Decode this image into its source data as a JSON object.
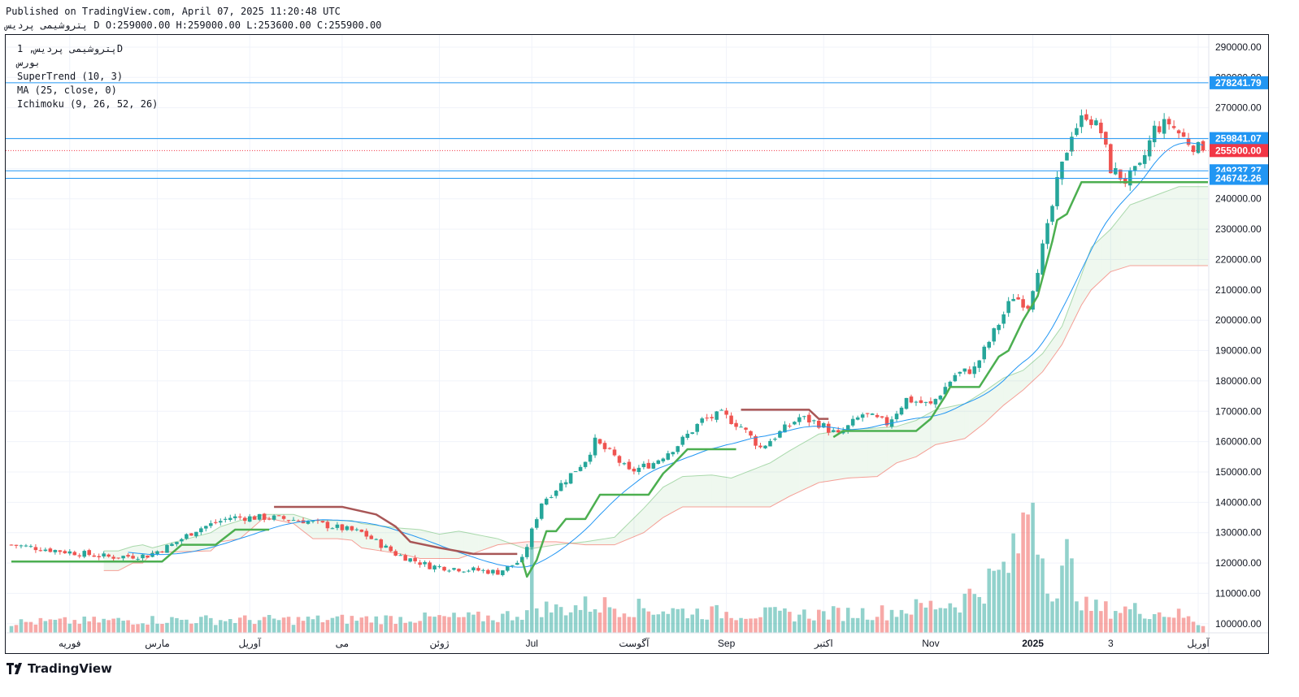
{
  "header": {
    "published": "Published on TradingView.com, April 07, 2025 11:20:48 UTC",
    "symbol_line": "پتروشیمی پردیس D O:259000.00 H:259000.00 L:253600.00 C:255900.00"
  },
  "legend": {
    "title": "پتروشیمی پردیس, 1D",
    "exchange": "بورس",
    "indicators": [
      "SuperTrend (10, 3)",
      "MA (25, close, 0)",
      "Ichimoku (9, 26, 52, 26)"
    ]
  },
  "brand": {
    "name": "TradingView",
    "icon": "tradingview-logo-icon"
  },
  "colors": {
    "up": "#26a69a",
    "down": "#ef5350",
    "supertrend_up": "#4caf50",
    "supertrend_down": "#a85656",
    "ma": "#2196f3",
    "hline": "#2196f3",
    "last_price": "#f23645",
    "cloud_bull": "#4caf50",
    "cloud_bear": "#f44336"
  },
  "chart_data": {
    "type": "candlestick",
    "title": "پتروشیمی پردیس, 1D",
    "ylim": [
      97000,
      294000
    ],
    "y_ticks": [
      100000,
      110000,
      120000,
      130000,
      140000,
      150000,
      160000,
      170000,
      180000,
      190000,
      200000,
      210000,
      220000,
      230000,
      240000,
      250000,
      260000,
      270000,
      280000,
      290000
    ],
    "y_tick_labels": [
      "100000.00",
      "110000.00",
      "120000.00",
      "130000.00",
      "140000.00",
      "150000.00",
      "160000.00",
      "170000.00",
      "180000.00",
      "190000.00",
      "200000.00",
      "210000.00",
      "220000.00",
      "230000.00",
      "240000.00",
      "250000.00",
      "260000.00",
      "270000.00",
      "280000.00",
      "290000.00"
    ],
    "x_labels": [
      {
        "label": "فوریه",
        "idx": 12
      },
      {
        "label": "مارس",
        "idx": 30
      },
      {
        "label": "آوریل",
        "idx": 49
      },
      {
        "label": "می",
        "idx": 68
      },
      {
        "label": "ژوئن",
        "idx": 88
      },
      {
        "label": "Jul",
        "idx": 107
      },
      {
        "label": "آگوست",
        "idx": 128
      },
      {
        "label": "Sep",
        "idx": 147
      },
      {
        "label": "اکتبر",
        "idx": 167
      },
      {
        "label": "Nov",
        "idx": 189
      },
      {
        "label": "2025",
        "idx": 210
      },
      {
        "label": "3",
        "idx": 226
      },
      {
        "label": "آوریل",
        "idx": 244
      }
    ],
    "horizontal_lines": [
      278241.79,
      259841.07,
      249237.27,
      246742.26
    ],
    "horizontal_line_labels": [
      "278241.79",
      "259841.07",
      "249237.27",
      "246742.26"
    ],
    "last_price": 255900,
    "last_price_label": "255900.00",
    "anchors": [
      [
        0,
        126000
      ],
      [
        10,
        124000
      ],
      [
        20,
        122000
      ],
      [
        28,
        122500
      ],
      [
        33,
        126000
      ],
      [
        38,
        131000
      ],
      [
        45,
        135000
      ],
      [
        53,
        135000
      ],
      [
        60,
        134000
      ],
      [
        66,
        132000
      ],
      [
        72,
        130000
      ],
      [
        79,
        123000
      ],
      [
        86,
        119000
      ],
      [
        93,
        118000
      ],
      [
        100,
        117000
      ],
      [
        105,
        121000
      ],
      [
        109,
        140000
      ],
      [
        113,
        146000
      ],
      [
        118,
        154000
      ],
      [
        120,
        160000
      ],
      [
        124,
        155000
      ],
      [
        127,
        150000
      ],
      [
        132,
        153000
      ],
      [
        137,
        159000
      ],
      [
        142,
        167000
      ],
      [
        146,
        169000
      ],
      [
        150,
        165000
      ],
      [
        154,
        158000
      ],
      [
        158,
        163000
      ],
      [
        162,
        168000
      ],
      [
        166,
        166000
      ],
      [
        170,
        162000
      ],
      [
        175,
        169000
      ],
      [
        180,
        166000
      ],
      [
        184,
        174000
      ],
      [
        189,
        172000
      ],
      [
        194,
        182000
      ],
      [
        198,
        184000
      ],
      [
        202,
        196000
      ],
      [
        206,
        208000
      ],
      [
        209,
        205000
      ],
      [
        213,
        230000
      ],
      [
        215,
        245000
      ],
      [
        218,
        262000
      ],
      [
        221,
        268000
      ],
      [
        224,
        262000
      ],
      [
        226,
        250000
      ],
      [
        229,
        246000
      ],
      [
        232,
        250000
      ],
      [
        235,
        263000
      ],
      [
        238,
        265000
      ],
      [
        241,
        260000
      ],
      [
        244,
        256500
      ],
      [
        245,
        255900
      ]
    ],
    "volume_anchors": [
      [
        0,
        4
      ],
      [
        30,
        5
      ],
      [
        60,
        5
      ],
      [
        100,
        6
      ],
      [
        106,
        8
      ],
      [
        107,
        28
      ],
      [
        108,
        10
      ],
      [
        112,
        9
      ],
      [
        120,
        11
      ],
      [
        125,
        10
      ],
      [
        140,
        8
      ],
      [
        160,
        7
      ],
      [
        180,
        8
      ],
      [
        195,
        12
      ],
      [
        203,
        22
      ],
      [
        206,
        28
      ],
      [
        208,
        40
      ],
      [
        210,
        57
      ],
      [
        212,
        30
      ],
      [
        215,
        14
      ],
      [
        217,
        28
      ],
      [
        219,
        18
      ],
      [
        221,
        10
      ],
      [
        225,
        9
      ],
      [
        230,
        9
      ],
      [
        240,
        7
      ],
      [
        245,
        3
      ]
    ],
    "n_candles": 246,
    "supertrend_points": [
      [
        0,
        120500
      ],
      [
        31,
        120500
      ],
      [
        35,
        126000
      ],
      [
        42,
        126000
      ],
      [
        46,
        131000
      ],
      [
        53,
        131000
      ],
      [
        54,
        138500
      ],
      [
        68,
        138500
      ],
      [
        75,
        136000
      ],
      [
        79,
        132000
      ],
      [
        82,
        127000
      ],
      [
        88,
        125000
      ],
      [
        95,
        123000
      ],
      [
        104,
        123000
      ],
      [
        105,
        121000
      ],
      [
        106,
        115500
      ],
      [
        108,
        121000
      ],
      [
        110,
        130500
      ],
      [
        112,
        130500
      ],
      [
        114,
        134500
      ],
      [
        118,
        134500
      ],
      [
        121,
        142500
      ],
      [
        131,
        142500
      ],
      [
        134,
        149500
      ],
      [
        136,
        152500
      ],
      [
        139,
        157500
      ],
      [
        149,
        157500
      ],
      [
        150,
        170500
      ],
      [
        164,
        170500
      ],
      [
        166,
        167500
      ],
      [
        168,
        167500
      ],
      [
        169,
        161500
      ],
      [
        171,
        163500
      ],
      [
        181,
        163500
      ],
      [
        186,
        163500
      ],
      [
        189,
        167500
      ],
      [
        192,
        175000
      ],
      [
        193,
        178000
      ],
      [
        199,
        178000
      ],
      [
        201,
        183000
      ],
      [
        203,
        188000
      ],
      [
        205,
        190000
      ],
      [
        208,
        200000
      ],
      [
        211,
        208000
      ],
      [
        214,
        226000
      ],
      [
        215,
        233000
      ],
      [
        217,
        235000
      ],
      [
        220,
        245500
      ],
      [
        246,
        245500
      ]
    ],
    "supertrend_flips": [
      54,
      105,
      150,
      169
    ],
    "y_axis_side": "right",
    "grid": true,
    "ichimoku_kijun": [
      [
        19,
        117500
      ],
      [
        22,
        117500
      ],
      [
        25,
        120000
      ],
      [
        27,
        120000
      ],
      [
        29,
        123500
      ],
      [
        41,
        124000
      ],
      [
        43,
        127000
      ],
      [
        47,
        128000
      ],
      [
        52,
        135000
      ],
      [
        58,
        133000
      ],
      [
        62,
        128000
      ],
      [
        67,
        128000
      ],
      [
        70,
        127500
      ],
      [
        72,
        125000
      ],
      [
        80,
        123000
      ],
      [
        84,
        121500
      ],
      [
        88,
        121500
      ],
      [
        92,
        121500
      ],
      [
        100,
        126000
      ],
      [
        106,
        127000
      ],
      [
        112,
        127000
      ],
      [
        118,
        126000
      ],
      [
        124,
        126000
      ],
      [
        130,
        130000
      ],
      [
        134,
        135000
      ],
      [
        138,
        138500
      ],
      [
        144,
        138500
      ],
      [
        148,
        138500
      ],
      [
        156,
        138500
      ],
      [
        160,
        142000
      ],
      [
        166,
        146500
      ],
      [
        172,
        148000
      ],
      [
        178,
        148500
      ],
      [
        182,
        153000
      ],
      [
        186,
        155000
      ],
      [
        190,
        159000
      ],
      [
        196,
        161000
      ],
      [
        200,
        166000
      ],
      [
        204,
        172000
      ],
      [
        208,
        177000
      ],
      [
        212,
        183000
      ],
      [
        216,
        192000
      ],
      [
        220,
        205000
      ],
      [
        222,
        210000
      ],
      [
        226,
        216000
      ],
      [
        230,
        218000
      ],
      [
        240,
        218000
      ],
      [
        246,
        218000
      ]
    ],
    "ichimoku_cloud_top": [
      [
        19,
        124000
      ],
      [
        22,
        124000
      ],
      [
        25,
        125500
      ],
      [
        27,
        126000
      ],
      [
        29,
        125000
      ],
      [
        41,
        130000
      ],
      [
        43,
        132000
      ],
      [
        47,
        134000
      ],
      [
        52,
        136000
      ],
      [
        58,
        136000
      ],
      [
        62,
        134000
      ],
      [
        67,
        134000
      ],
      [
        70,
        134000
      ],
      [
        72,
        133000
      ],
      [
        80,
        131500
      ],
      [
        84,
        131000
      ],
      [
        88,
        129500
      ],
      [
        92,
        130500
      ],
      [
        100,
        128000
      ],
      [
        106,
        124500
      ],
      [
        112,
        126000
      ],
      [
        118,
        127000
      ],
      [
        124,
        128500
      ],
      [
        130,
        138000
      ],
      [
        134,
        145000
      ],
      [
        138,
        148500
      ],
      [
        144,
        149000
      ],
      [
        148,
        148000
      ],
      [
        156,
        153000
      ],
      [
        160,
        157000
      ],
      [
        166,
        162500
      ],
      [
        172,
        164000
      ],
      [
        178,
        164500
      ],
      [
        182,
        165000
      ],
      [
        186,
        167000
      ],
      [
        190,
        170500
      ],
      [
        196,
        172500
      ],
      [
        200,
        176500
      ],
      [
        204,
        181000
      ],
      [
        208,
        183500
      ],
      [
        212,
        189000
      ],
      [
        216,
        198000
      ],
      [
        220,
        215000
      ],
      [
        222,
        224000
      ],
      [
        226,
        230000
      ],
      [
        230,
        238000
      ],
      [
        240,
        244000
      ],
      [
        246,
        244000
      ]
    ]
  }
}
